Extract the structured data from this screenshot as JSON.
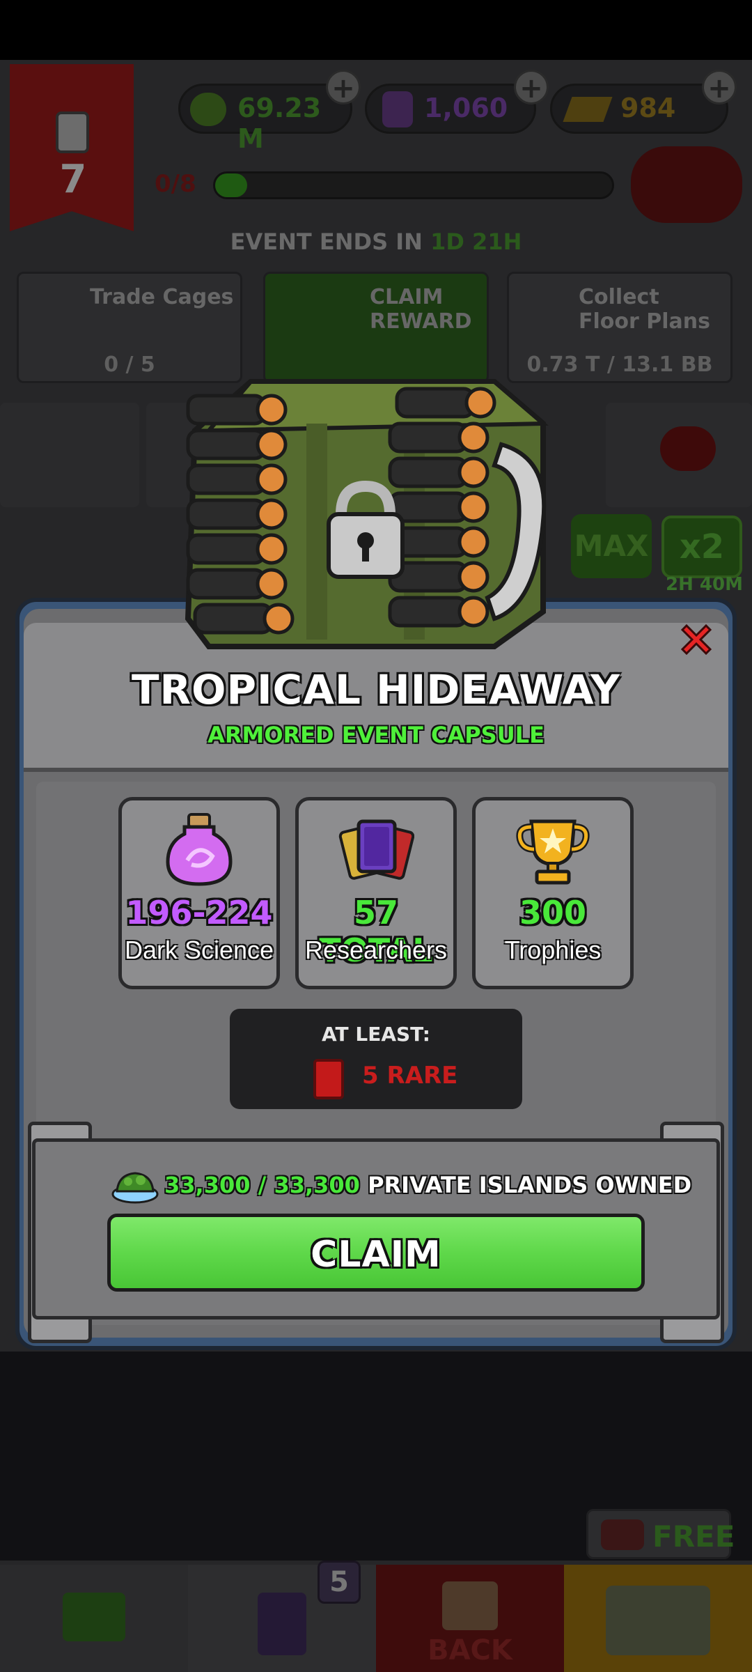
{
  "background": {
    "level": "7",
    "resources": [
      {
        "name": "cash",
        "value": "69.23 M"
      },
      {
        "name": "dark-science",
        "value": "1,060"
      },
      {
        "name": "gold",
        "value": "984"
      }
    ],
    "progress_label": "0/8",
    "progress_fraction": 0.08,
    "event_ends_label": "EVENT ENDS IN",
    "event_ends_days": "1D",
    "event_ends_hours": "21H",
    "tasks": [
      {
        "title": "Trade Cages",
        "value": "0 / 5"
      },
      {
        "title": "CLAIM REWARD",
        "value": ""
      },
      {
        "title": "Collect Floor Plans",
        "value": "0.73 T / 13.1 BB"
      }
    ],
    "max_label": "MAX",
    "x2_label": "x2",
    "x2_timer": "2H 40M",
    "free_label": "FREE",
    "nav_badge": "5",
    "nav_back": "BACK"
  },
  "modal": {
    "title": "TROPICAL HIDEAWAY",
    "subtitle": "ARMORED EVENT CAPSULE",
    "rewards": [
      {
        "value": "196-224",
        "label": "Dark Science",
        "color": "#c25bff",
        "icon": "dark-science-jar-icon"
      },
      {
        "value": "57 TOTAL",
        "label": "Researchers",
        "color": "#49e83a",
        "icon": "researcher-cards-icon"
      },
      {
        "value": "300",
        "label": "Trophies",
        "color": "#49e83a",
        "icon": "trophy-icon"
      }
    ],
    "at_least_label": "AT LEAST:",
    "rare_label": "5 RARE",
    "owned_count": "33,300 / 33,300",
    "owned_label": "PRIVATE ISLANDS OWNED",
    "claim_label": "CLAIM"
  }
}
